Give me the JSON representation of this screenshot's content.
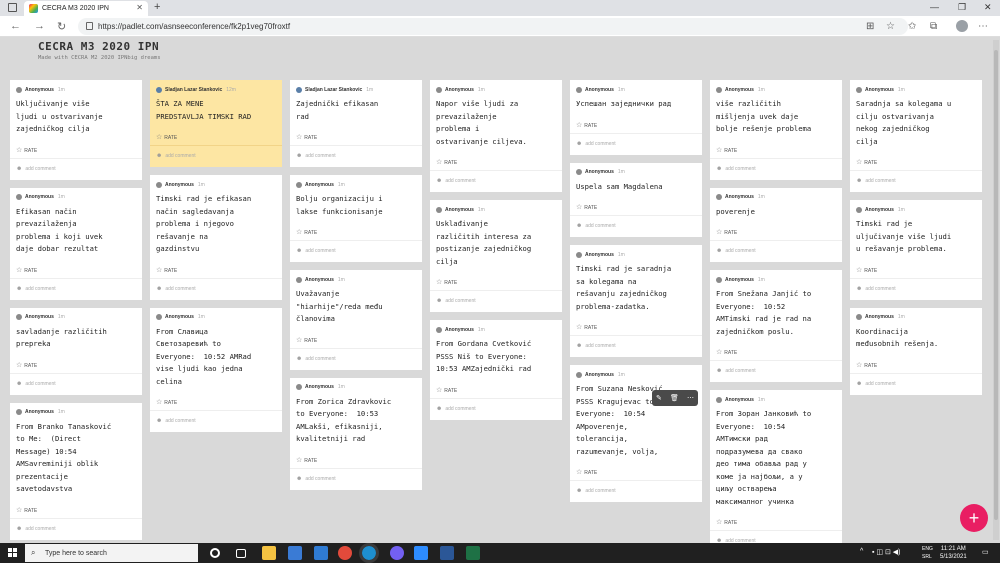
{
  "browser": {
    "tab_title": "CECRA M3 2020 IPN",
    "url": "https://padlet.com/asnseeconference/fk2p1veg70froxtf"
  },
  "padlet": {
    "title": "CECRA M3 2020 IPN",
    "subtitle": "Made with CECRA M2 2020 IPNbig dreams",
    "rate_label": "RATE",
    "comment_placeholder": "add comment"
  },
  "columns": [
    {
      "cards": [
        {
          "author": "Anonymous",
          "ago": "1m",
          "text": "Uključivanje više\nljudi u ostvarivanje\nzajedničkog cilja"
        },
        {
          "author": "Anonymous",
          "ago": "1m",
          "text": "Efikasan način\nprevazilaženja\nproblema i koji uvek\ndaje dobar rezultat"
        },
        {
          "author": "Anonymous",
          "ago": "1m",
          "text": "savladanje različitih\nprepreka"
        },
        {
          "author": "Anonymous",
          "ago": "1m",
          "text": "From Branko Tanasković\nto Me:  (Direct\nMessage) 10:54\nAMSavreminiji oblik\nprezentacije\nsavetodavstva"
        }
      ]
    },
    {
      "cards": [
        {
          "author": "Sladjan Lazar Stankovic",
          "ago": "12m",
          "text": "ŠTA ZA MENE\nPREDSTAVLJA TIMSKI RAD",
          "yellow": true
        },
        {
          "author": "Anonymous",
          "ago": "1m",
          "text": "Timski rad je efikasan\nnačin sagledavanja\nproblema i njegovo\nrešavanje na\ngazdinstvu"
        },
        {
          "author": "Anonymous",
          "ago": "1m",
          "text": "From Славица\nСветозаревић to\nEveryone:  10:52 AMRad\nvise ljudi kao jedna\ncelina"
        }
      ]
    },
    {
      "cards": [
        {
          "author": "Sladjan Lazar Stankovic",
          "ago": "1m",
          "text": "Zajednički efikasan\nrad"
        },
        {
          "author": "Anonymous",
          "ago": "1m",
          "text": "Bolju organizaciju i\nlakse funkcionisanje"
        },
        {
          "author": "Anonymous",
          "ago": "1m",
          "text": "Uvažavanje\n\"hiarhije\"/reda među\nčlanovima"
        },
        {
          "author": "Anonymous",
          "ago": "1m",
          "text": "From Zorica Zdravkovic\nto Everyone:  10:53\nAMLakši, efikasniji,\nkvalitetniji rad"
        }
      ]
    },
    {
      "cards": [
        {
          "author": "Anonymous",
          "ago": "1m",
          "text": "Napor više ljudi za\nprevazilaženje\nproblema i\nostvarivanje ciljeva."
        },
        {
          "author": "Anonymous",
          "ago": "1m",
          "text": "Usklađivanje\nrazličitih interesa za\npostizanje zajedničkog\ncilja"
        },
        {
          "author": "Anonymous",
          "ago": "1m",
          "text": "From Gordana Cvetković\nPSSS Niš to Everyone:\n10:53 AMZajednički rad"
        }
      ]
    },
    {
      "cards": [
        {
          "author": "Anonymous",
          "ago": "1m",
          "text": "Успешан заједнички рад"
        },
        {
          "author": "Anonymous",
          "ago": "1m",
          "text": "Uspela sam Magdalena"
        },
        {
          "author": "Anonymous",
          "ago": "1m",
          "text": "Timski rad je saradnja\nsa kolegama na\nrešavanju zajedničkog\nproblema-zadatka."
        },
        {
          "author": "Anonymous",
          "ago": "1m",
          "text": "From Suzana Nesković\nPSSS Kragujevac to\nEveryone:  10:54\nAMpoverenje,\ntolerancija,\nrazumevanje, volja,"
        }
      ]
    },
    {
      "cards": [
        {
          "author": "Anonymous",
          "ago": "1m",
          "text": "više različitih\nmišljenja uvek daje\nbolje rešenje problema"
        },
        {
          "author": "Anonymous",
          "ago": "1m",
          "text": "poverenje"
        },
        {
          "author": "Anonymous",
          "ago": "1m",
          "text": "From Snežana Janjić to\nEveryone:  10:52\nAMTimski rad je rad na\nzajedničkom poslu."
        },
        {
          "author": "Anonymous",
          "ago": "1m",
          "text": "From Зоран Јанковић to\nEveryone:  10:54\nAMТимски рад\nподразумева да свако\nдео тима обавља рад у\nкоме ја најбољи, а у\nциљу остварења\nмаксималног учинка"
        }
      ]
    },
    {
      "cards": [
        {
          "author": "Anonymous",
          "ago": "1m",
          "text": "Saradnja sa kolegama u\ncilju ostvarivanja\nnekog zajedničkog\ncilja"
        },
        {
          "author": "Anonymous",
          "ago": "1m",
          "text": "Timski rad je\nuljučivanje više ljudi\nu rešavanje problema."
        },
        {
          "author": "Anonymous",
          "ago": "1m",
          "text": "Koordinacija\nmeđusobnih rešenja."
        }
      ]
    }
  ],
  "taskbar": {
    "search_placeholder": "Type here to search",
    "lang_top": "ENG",
    "lang_bottom": "SRL",
    "time": "11:21 AM",
    "date": "5/13/2021"
  }
}
